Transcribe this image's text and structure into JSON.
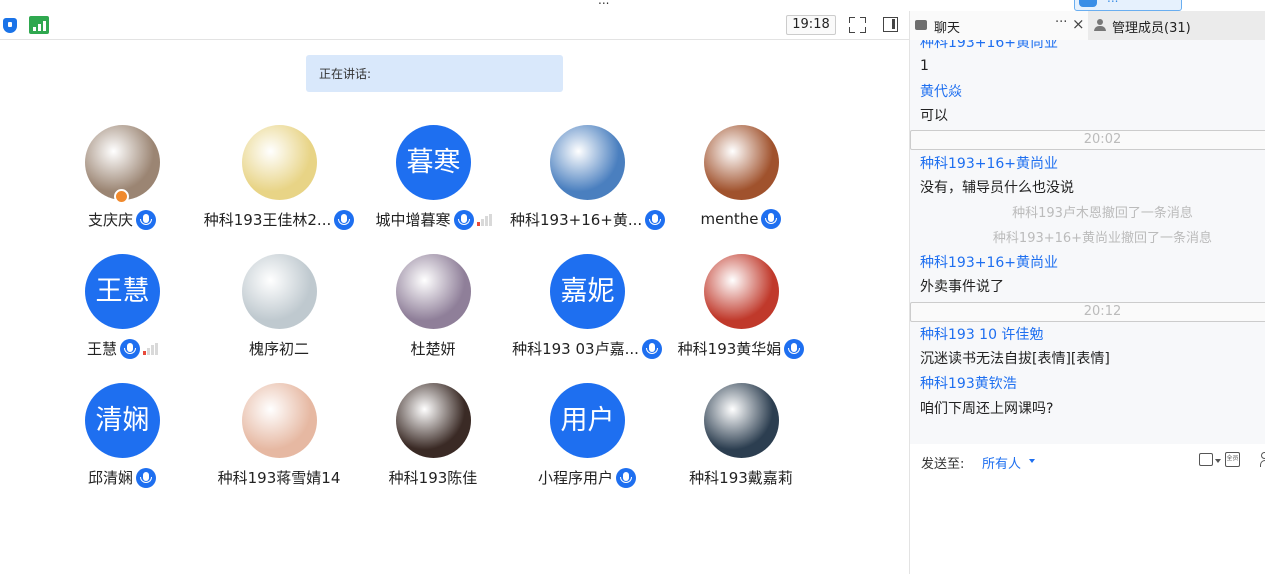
{
  "window": {
    "title_fragment": "...",
    "upload_button": "..."
  },
  "toolbar": {
    "time": "19:18"
  },
  "stage": {
    "speaking_label": "正在讲话:"
  },
  "participants": [
    {
      "name": "支庆庆",
      "initials": "",
      "mic": true,
      "volume": false,
      "host": true,
      "color": "#9b8573"
    },
    {
      "name": "种科193王佳林2...",
      "initials": "",
      "mic": true,
      "volume": false,
      "host": false,
      "color": "#e8d486"
    },
    {
      "name": "城中增暮寒",
      "initials": "暮寒",
      "mic": true,
      "volume": true,
      "host": false,
      "color": "#1e6ff0"
    },
    {
      "name": "种科193+16+黄...",
      "initials": "",
      "mic": true,
      "volume": false,
      "host": false,
      "color": "#4a7fbf"
    },
    {
      "name": "menthe",
      "initials": "",
      "mic": true,
      "volume": false,
      "host": false,
      "color": "#a0522d"
    },
    {
      "name": "王慧",
      "initials": "王慧",
      "mic": true,
      "volume": true,
      "host": false,
      "color": "#1e6ff0"
    },
    {
      "name": "槐序初二",
      "initials": "",
      "mic": false,
      "volume": false,
      "host": false,
      "color": "#bfc9cf"
    },
    {
      "name": "杜楚妍",
      "initials": "",
      "mic": false,
      "volume": false,
      "host": false,
      "color": "#8f7f99"
    },
    {
      "name": "种科193 03卢嘉...",
      "initials": "嘉妮",
      "mic": true,
      "volume": false,
      "host": false,
      "color": "#1e6ff0"
    },
    {
      "name": "种科193黄华娟",
      "initials": "",
      "mic": true,
      "volume": false,
      "host": false,
      "color": "#c0392b"
    },
    {
      "name": "邱清娴",
      "initials": "清娴",
      "mic": true,
      "volume": false,
      "host": false,
      "color": "#1e6ff0"
    },
    {
      "name": "种科193蒋雪婧14",
      "initials": "",
      "mic": false,
      "volume": false,
      "host": false,
      "color": "#e6b8a2"
    },
    {
      "name": "种科193陈佳",
      "initials": "",
      "mic": false,
      "volume": false,
      "host": false,
      "color": "#3a2a25"
    },
    {
      "name": "小程序用户",
      "initials": "用户",
      "mic": true,
      "volume": false,
      "host": false,
      "color": "#1e6ff0"
    },
    {
      "name": "种科193戴嘉莉",
      "initials": "",
      "mic": false,
      "volume": false,
      "host": false,
      "color": "#2c3e50"
    }
  ],
  "chat_header": {
    "chat_tab": "聊天",
    "more": "···",
    "close": "×",
    "members_tab": "管理成员(31)"
  },
  "chat": [
    {
      "type": "sender",
      "text": "种科193+16+黄尚业"
    },
    {
      "type": "text",
      "text": "1"
    },
    {
      "type": "sender",
      "text": "黄代焱"
    },
    {
      "type": "text",
      "text": "可以"
    },
    {
      "type": "time",
      "text": "20:02"
    },
    {
      "type": "sender",
      "text": "种科193+16+黄尚业"
    },
    {
      "type": "text",
      "text": "没有，辅导员什么也没说"
    },
    {
      "type": "recall",
      "text": "种科193卢木恩撤回了一条消息"
    },
    {
      "type": "recall",
      "text": "种科193+16+黄尚业撤回了一条消息"
    },
    {
      "type": "sender",
      "text": "种科193+16+黄尚业"
    },
    {
      "type": "text",
      "text": "外卖事件说了"
    },
    {
      "type": "time",
      "text": "20:12"
    },
    {
      "type": "sender",
      "text": "种科193 10 许佳勉"
    },
    {
      "type": "text",
      "text": "沉迷读书无法自拔[表情][表情]"
    },
    {
      "type": "sender",
      "text": "种科193黄钦浩"
    },
    {
      "type": "text",
      "text": "咱们下周还上网课吗?"
    }
  ],
  "send": {
    "label": "发送至:",
    "target": "所有人",
    "all_icon": "全员"
  }
}
